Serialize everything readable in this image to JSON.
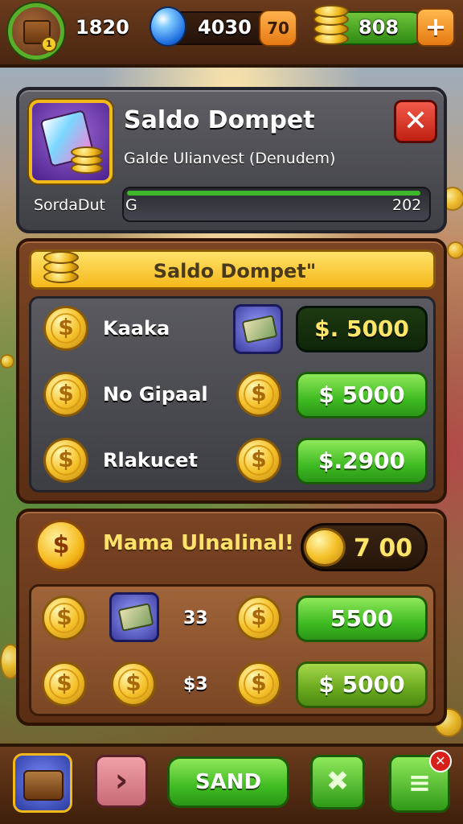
{
  "topbar": {
    "level": "1",
    "player_stat": "1820",
    "gems": "4030",
    "gem_bonus": "70",
    "coins": "808",
    "add_label": "+"
  },
  "header": {
    "title": "Saldo Dompet",
    "subtitle": "Galde Ulianvest (Denudem)",
    "close_label": "✕",
    "progress_label": "SordaDut",
    "progress_prefix": "G",
    "progress_value_text": "202",
    "progress_fraction": 0.98
  },
  "wallet": {
    "ribbon_title": "Saldo Dompet\"",
    "currency_glyph": "$",
    "rows": [
      {
        "label": "Kaaka",
        "price": "$. 5000"
      },
      {
        "label": "No Gipaal",
        "price": "$ 5000"
      },
      {
        "label": "Rlakucet",
        "price": "$.2900"
      }
    ]
  },
  "bonus": {
    "sun_glyph": "$",
    "title": "Mama Ulnalinal!",
    "value": "7 00",
    "rows": [
      {
        "amount": "33",
        "price": "5500"
      },
      {
        "amount": "$3",
        "price": "$ 5000"
      }
    ]
  },
  "bottombar": {
    "arrow_glyph": "›",
    "send_label": "SAND",
    "tool_glyph": "✖",
    "menu_glyph": "≡",
    "notif_glyph": "✕"
  }
}
